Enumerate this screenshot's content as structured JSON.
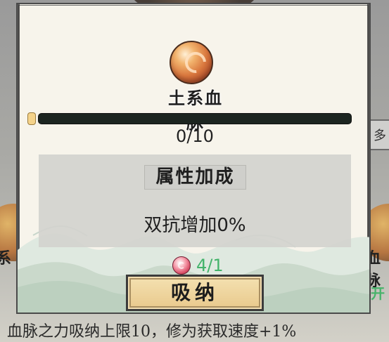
{
  "background": {
    "right_tab_text": "多",
    "left_side_label": "系",
    "right_side_label": "血脉",
    "right_side_green_text": "开",
    "bottom_text": "血脉之力吸纳上限10，修为获取速度+1%"
  },
  "popup": {
    "emblem": {
      "title": "土系血脉",
      "icon": "earth-bloodline-orb-icon"
    },
    "progress": {
      "text": "0/10",
      "current": 0,
      "max": 10
    },
    "attributes": {
      "title": "属性加成",
      "value": "双抗增加0%"
    },
    "cost": {
      "icon": "bloodline-essence-icon",
      "text": "4/1"
    },
    "button": {
      "label": "吸纳"
    }
  },
  "colors": {
    "dialog_bg": "#f7f4eb",
    "progress_track": "#1c2520",
    "cost_text": "#43b36a",
    "button_bg": "#efd8a2"
  }
}
